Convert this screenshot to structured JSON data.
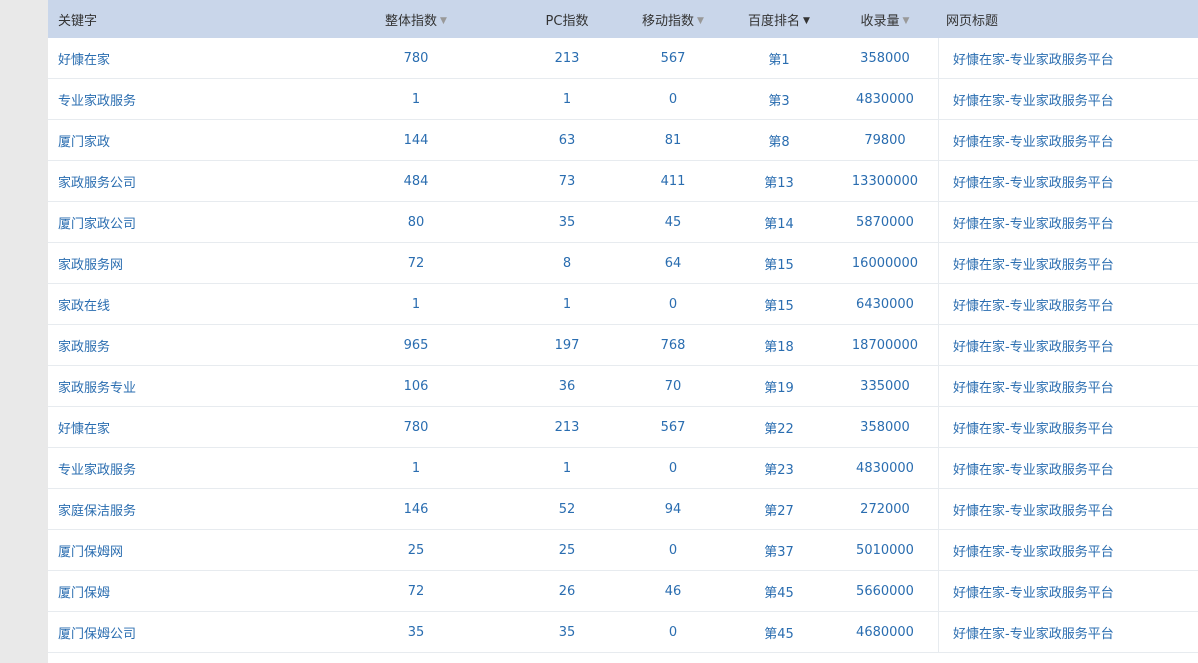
{
  "header": {
    "keyword": "关键字",
    "overall_index": "整体指数",
    "pc_index": "PC指数",
    "mobile_index": "移动指数",
    "baidu_rank": "百度排名",
    "indexed": "收录量",
    "page_title": "网页标题"
  },
  "rows": [
    {
      "keyword": "好慷在家",
      "overall": "780",
      "pc": "213",
      "mobile": "567",
      "rank": "第1",
      "indexed": "358000",
      "title": "好慷在家-专业家政服务平台"
    },
    {
      "keyword": "专业家政服务",
      "overall": "1",
      "pc": "1",
      "mobile": "0",
      "rank": "第3",
      "indexed": "4830000",
      "title": "好慷在家-专业家政服务平台"
    },
    {
      "keyword": "厦门家政",
      "overall": "144",
      "pc": "63",
      "mobile": "81",
      "rank": "第8",
      "indexed": "79800",
      "title": "好慷在家-专业家政服务平台"
    },
    {
      "keyword": "家政服务公司",
      "overall": "484",
      "pc": "73",
      "mobile": "411",
      "rank": "第13",
      "indexed": "13300000",
      "title": "好慷在家-专业家政服务平台"
    },
    {
      "keyword": "厦门家政公司",
      "overall": "80",
      "pc": "35",
      "mobile": "45",
      "rank": "第14",
      "indexed": "5870000",
      "title": "好慷在家-专业家政服务平台"
    },
    {
      "keyword": "家政服务网",
      "overall": "72",
      "pc": "8",
      "mobile": "64",
      "rank": "第15",
      "indexed": "16000000",
      "title": "好慷在家-专业家政服务平台"
    },
    {
      "keyword": "家政在线",
      "overall": "1",
      "pc": "1",
      "mobile": "0",
      "rank": "第15",
      "indexed": "6430000",
      "title": "好慷在家-专业家政服务平台"
    },
    {
      "keyword": "家政服务",
      "overall": "965",
      "pc": "197",
      "mobile": "768",
      "rank": "第18",
      "indexed": "18700000",
      "title": "好慷在家-专业家政服务平台"
    },
    {
      "keyword": "家政服务专业",
      "overall": "106",
      "pc": "36",
      "mobile": "70",
      "rank": "第19",
      "indexed": "335000",
      "title": "好慷在家-专业家政服务平台"
    },
    {
      "keyword": "好慷在家",
      "overall": "780",
      "pc": "213",
      "mobile": "567",
      "rank": "第22",
      "indexed": "358000",
      "title": "好慷在家-专业家政服务平台"
    },
    {
      "keyword": "专业家政服务",
      "overall": "1",
      "pc": "1",
      "mobile": "0",
      "rank": "第23",
      "indexed": "4830000",
      "title": "好慷在家-专业家政服务平台"
    },
    {
      "keyword": "家庭保洁服务",
      "overall": "146",
      "pc": "52",
      "mobile": "94",
      "rank": "第27",
      "indexed": "272000",
      "title": "好慷在家-专业家政服务平台"
    },
    {
      "keyword": "厦门保姆网",
      "overall": "25",
      "pc": "25",
      "mobile": "0",
      "rank": "第37",
      "indexed": "5010000",
      "title": "好慷在家-专业家政服务平台"
    },
    {
      "keyword": "厦门保姆",
      "overall": "72",
      "pc": "26",
      "mobile": "46",
      "rank": "第45",
      "indexed": "5660000",
      "title": "好慷在家-专业家政服务平台"
    },
    {
      "keyword": "厦门保姆公司",
      "overall": "35",
      "pc": "35",
      "mobile": "0",
      "rank": "第45",
      "indexed": "4680000",
      "title": "好慷在家-专业家政服务平台"
    }
  ]
}
